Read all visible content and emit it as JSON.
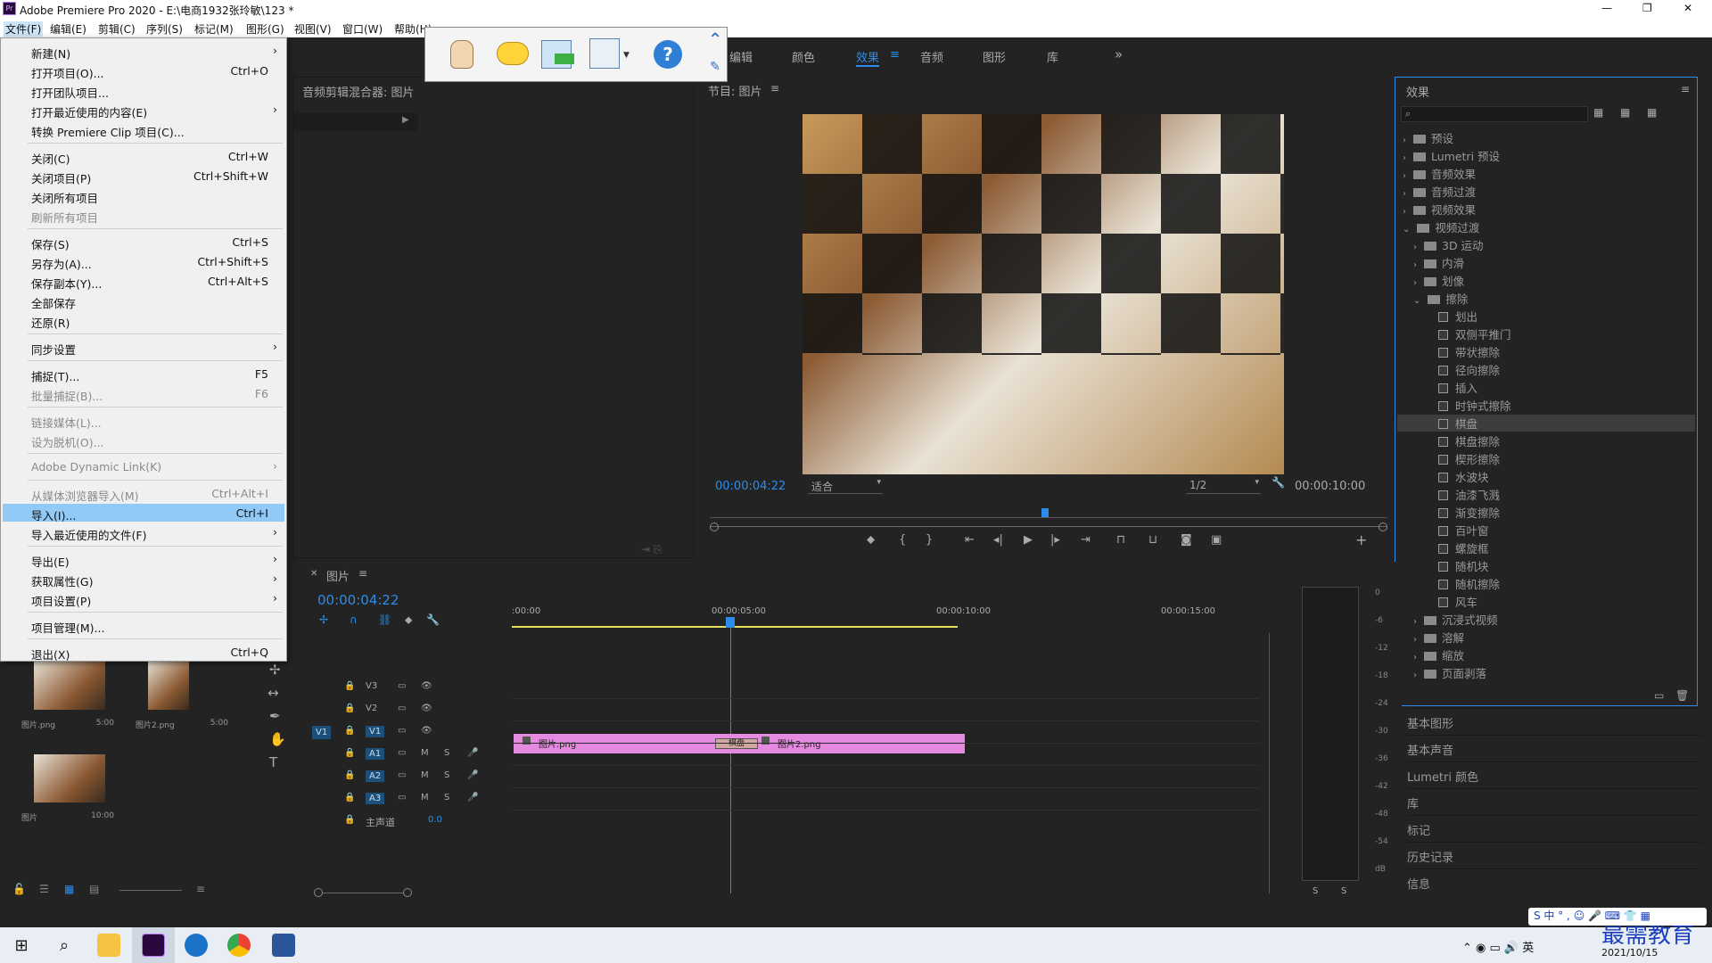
{
  "window": {
    "title": "Adobe Premiere Pro 2020 - E:\\电商1932张玲敏\\123 *",
    "minimize": "—",
    "maximize": "❐",
    "close": "✕"
  },
  "menubar": [
    "文件(F)",
    "编辑(E)",
    "剪辑(C)",
    "序列(S)",
    "标记(M)",
    "图形(G)",
    "视图(V)",
    "窗口(W)",
    "帮助(H)"
  ],
  "file_menu": [
    {
      "label": "新建(N)",
      "shortcut": "",
      "arrow": "›",
      "disabled": false
    },
    {
      "label": "打开项目(O)...",
      "shortcut": "Ctrl+O",
      "arrow": "",
      "disabled": false
    },
    {
      "label": "打开团队项目...",
      "shortcut": "",
      "arrow": "",
      "disabled": false
    },
    {
      "label": "打开最近使用的内容(E)",
      "shortcut": "",
      "arrow": "›",
      "disabled": false
    },
    {
      "label": "转换 Premiere Clip 项目(C)...",
      "shortcut": "",
      "arrow": "",
      "disabled": false
    },
    {
      "label": "关闭(C)",
      "shortcut": "Ctrl+W",
      "arrow": "",
      "disabled": false
    },
    {
      "label": "关闭项目(P)",
      "shortcut": "Ctrl+Shift+W",
      "arrow": "",
      "disabled": false
    },
    {
      "label": "关闭所有项目",
      "shortcut": "",
      "arrow": "",
      "disabled": false
    },
    {
      "label": "刷新所有项目",
      "shortcut": "",
      "arrow": "",
      "disabled": true
    },
    {
      "label": "保存(S)",
      "shortcut": "Ctrl+S",
      "arrow": "",
      "disabled": false
    },
    {
      "label": "另存为(A)...",
      "shortcut": "Ctrl+Shift+S",
      "arrow": "",
      "disabled": false
    },
    {
      "label": "保存副本(Y)...",
      "shortcut": "Ctrl+Alt+S",
      "arrow": "",
      "disabled": false
    },
    {
      "label": "全部保存",
      "shortcut": "",
      "arrow": "",
      "disabled": false
    },
    {
      "label": "还原(R)",
      "shortcut": "",
      "arrow": "",
      "disabled": false
    },
    {
      "label": "同步设置",
      "shortcut": "",
      "arrow": "›",
      "disabled": false
    },
    {
      "label": "捕捉(T)...",
      "shortcut": "F5",
      "arrow": "",
      "disabled": false
    },
    {
      "label": "批量捕捉(B)...",
      "shortcut": "F6",
      "arrow": "",
      "disabled": true
    },
    {
      "label": "链接媒体(L)...",
      "shortcut": "",
      "arrow": "",
      "disabled": true
    },
    {
      "label": "设为脱机(O)...",
      "shortcut": "",
      "arrow": "",
      "disabled": true
    },
    {
      "label": "Adobe Dynamic Link(K)",
      "shortcut": "",
      "arrow": "›",
      "disabled": true
    },
    {
      "label": "从媒体浏览器导入(M)",
      "shortcut": "Ctrl+Alt+I",
      "arrow": "",
      "disabled": true
    },
    {
      "label": "导入(I)...",
      "shortcut": "Ctrl+I",
      "arrow": "",
      "disabled": false,
      "highlighted": true
    },
    {
      "label": "导入最近使用的文件(F)",
      "shortcut": "",
      "arrow": "›",
      "disabled": false
    },
    {
      "label": "导出(E)",
      "shortcut": "",
      "arrow": "›",
      "disabled": false
    },
    {
      "label": "获取属性(G)",
      "shortcut": "",
      "arrow": "›",
      "disabled": false
    },
    {
      "label": "项目设置(P)",
      "shortcut": "",
      "arrow": "›",
      "disabled": false
    },
    {
      "label": "项目管理(M)...",
      "shortcut": "",
      "arrow": "",
      "disabled": false
    },
    {
      "label": "退出(X)",
      "shortcut": "Ctrl+Q",
      "arrow": "",
      "disabled": false
    }
  ],
  "workspace_tabs": {
    "edit": "编辑",
    "color": "颜色",
    "effects": "效果",
    "audio": "音频",
    "graphics": "图形",
    "libraries": "库",
    "more": "»"
  },
  "audio_mixer": {
    "title": "音频剪辑混合器: 图片"
  },
  "program_monitor": {
    "title": "节目: 图片",
    "timecode": "00:00:04:22",
    "fit": "适合",
    "quality": "1/2",
    "duration": "00:00:10:00",
    "playhead_fraction": 0.49
  },
  "timeline": {
    "title": "图片",
    "timecode": "00:00:04:22",
    "ruler": [
      ":00:00",
      "00:00:05:00",
      "00:00:10:00",
      "00:00:15:00"
    ],
    "tracks": [
      {
        "name": "V3",
        "ctl": ""
      },
      {
        "name": "V2",
        "ctl": ""
      },
      {
        "name": "V1",
        "ctl": "V1"
      },
      {
        "name": "A1",
        "ctl": "M S"
      },
      {
        "name": "A2",
        "ctl": "M S"
      },
      {
        "name": "A3",
        "ctl": "M S"
      }
    ],
    "master": {
      "label": "主声道",
      "value": "0.0"
    },
    "clips": [
      {
        "name": "图片.png"
      },
      {
        "name": "图片2.png"
      }
    ],
    "transition": "棋盘"
  },
  "project_items": [
    {
      "name": "图片.png",
      "duration": "5:00"
    },
    {
      "name": "图片2.png",
      "duration": "5:00"
    },
    {
      "name": "图片",
      "duration": "10:00"
    }
  ],
  "effects_panel": {
    "title": "效果",
    "search_placeholder": "",
    "folders": [
      "预设",
      "Lumetri 预设",
      "音频效果",
      "音频过渡",
      "视频效果",
      "视频过渡"
    ],
    "sub_folders": [
      "3D 运动",
      "内滑",
      "划像",
      "擦除"
    ],
    "wipe_items": [
      "划出",
      "双侧平推门",
      "带状擦除",
      "径向擦除",
      "插入",
      "时钟式擦除",
      "棋盘",
      "棋盘擦除",
      "楔形擦除",
      "水波块",
      "油漆飞溅",
      "渐变擦除",
      "百叶窗",
      "螺旋框",
      "随机块",
      "随机擦除",
      "风车"
    ],
    "selected_item": "棋盘",
    "more_folders": [
      "沉浸式视频",
      "溶解",
      "缩放",
      "页面剥落"
    ]
  },
  "side_panels": [
    "基本图形",
    "基本声音",
    "Lumetri 颜色",
    "库",
    "标记",
    "历史记录",
    "信息"
  ],
  "meter": {
    "ticks": [
      "0",
      "-6",
      "-12",
      "-18",
      "-24",
      "-30",
      "-36",
      "-42",
      "-48",
      "-54",
      "dB"
    ],
    "solo": [
      "S",
      "S"
    ]
  },
  "taskbar": {
    "date": "2021/10/15"
  },
  "watermark": "最需教育",
  "colors": {
    "accent": "#2d8ceb",
    "clip": "#e58ae0",
    "menu_highlight": "#91c9f7"
  }
}
